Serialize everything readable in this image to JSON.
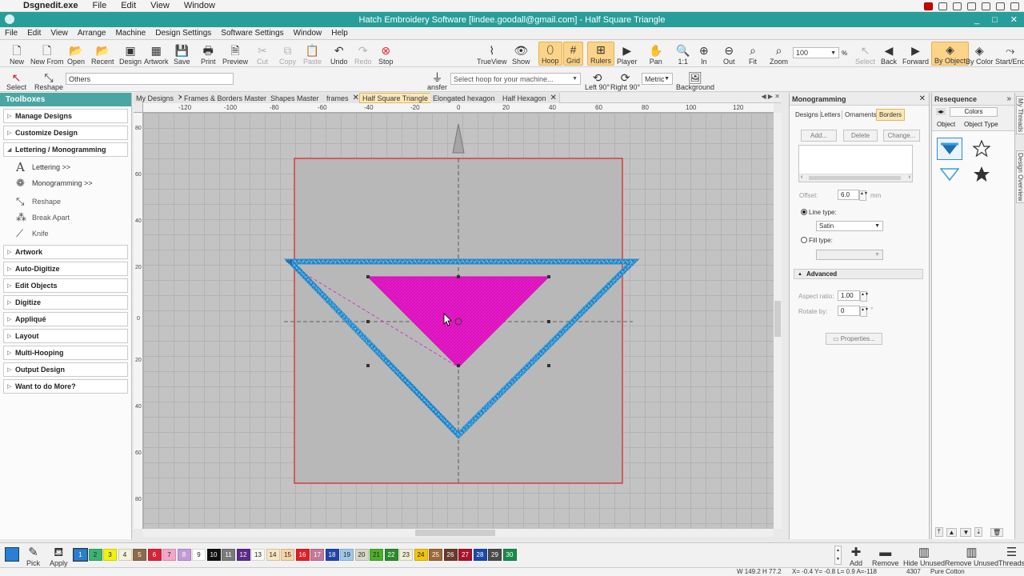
{
  "mac_menu": {
    "app": "Dsgnedit.exe",
    "items": [
      "File",
      "Edit",
      "View",
      "Window"
    ]
  },
  "title": "Hatch Embroidery Software [lindee.goodall@gmail.com] - Half Square Triangle",
  "window_controls": [
    "_",
    "□",
    "✕"
  ],
  "menu": [
    "File",
    "Edit",
    "View",
    "Arrange",
    "Machine",
    "Design Settings",
    "Software Settings",
    "Window",
    "Help"
  ],
  "toolbar": {
    "new": "New",
    "new_from": "New From",
    "open": "Open",
    "recent": "Recent",
    "design": "Design",
    "artwork": "Artwork",
    "save": "Save",
    "print": "Print",
    "preview": "Preview",
    "cut": "Cut",
    "copy": "Copy",
    "paste": "Paste",
    "undo": "Undo",
    "redo": "Redo",
    "stop": "Stop",
    "trueview": "TrueView",
    "show": "Show",
    "hoop": "Hoop",
    "grid": "Grid",
    "rulers": "Rulers",
    "player": "Player",
    "pan": "Pan",
    "one_to_one": "1:1",
    "zoom_in": "In",
    "zoom_out": "Out",
    "fit": "Fit",
    "zoom": "Zoom",
    "zoom_value": "100",
    "zoom_unit": "%",
    "select": "Select",
    "back": "Back",
    "forward": "Forward",
    "by_object": "By Object",
    "by_color": "By Color",
    "start_end": "Start/End"
  },
  "toolbar2": {
    "select": "Select",
    "reshape": "Reshape",
    "others": "Others",
    "transfer": "ansfer",
    "hoop_placeholder": "Select hoop for your machine...",
    "left90": "Left 90°",
    "right90": "Right 90°",
    "metric": "Metric",
    "background": "Background"
  },
  "toolboxes": {
    "header": "Toolboxes",
    "sections_top": [
      "Manage Designs",
      "Customize Design",
      "Lettering / Monogramming"
    ],
    "lettering_items": [
      "Lettering >>",
      "Monogramming >>",
      "Reshape",
      "Break Apart",
      "Knife"
    ],
    "sections_bottom": [
      "Artwork",
      "Auto-Digitize",
      "Edit Objects",
      "Digitize",
      "Appliqué",
      "Layout",
      "Multi-Hooping",
      "Output Design",
      "Want to do More?"
    ]
  },
  "doc_tabs": [
    "My Designs",
    "Frames & Borders Master",
    "Shapes Master",
    "frames",
    "Half Square Triangle",
    "Elongated hexagon",
    "Half Hexagon"
  ],
  "ruler_top": [
    "-120",
    "-100",
    "-80",
    "-60",
    "-40",
    "-20",
    "0",
    "20",
    "40",
    "60",
    "80",
    "100",
    "120"
  ],
  "ruler_left": [
    "80",
    "60",
    "40",
    "20",
    "0",
    "20",
    "40",
    "60",
    "80"
  ],
  "monogramming": {
    "title": "Monogramming",
    "tabs": [
      "Designs",
      "Letters",
      "Ornaments",
      "Borders"
    ],
    "add": "Add...",
    "delete": "Delete",
    "change": "Change...",
    "offset_label": "Offset:",
    "offset_value": "6.0",
    "offset_unit": "mm",
    "line_type": "Line type:",
    "line_value": "Satin",
    "fill_type": "Fill type:",
    "advanced": "Advanced",
    "aspect_label": "Aspect ratio:",
    "aspect_value": "1.00",
    "rotate_label": "Rotate by:",
    "rotate_value": "0",
    "rotate_unit": "°",
    "properties": "Properties..."
  },
  "resequence": {
    "title": "Resequence",
    "colors": "Colors",
    "object": "Object",
    "object_type": "Object Type"
  },
  "side_tabs": [
    "My Threads",
    "Design Overview"
  ],
  "bottom": {
    "pick": "Pick",
    "apply": "Apply",
    "add": "Add",
    "remove": "Remove",
    "hide_unused": "Hide Unused",
    "remove_unused": "Remove Unused",
    "threads": "Threads"
  },
  "swatches": [
    {
      "n": "1",
      "c": "#2a7fd4"
    },
    {
      "n": "2",
      "c": "#3cb371"
    },
    {
      "n": "3",
      "c": "#f2f20c"
    },
    {
      "n": "4",
      "c": "#f5f0dc"
    },
    {
      "n": "5",
      "c": "#8b6b4a"
    },
    {
      "n": "6",
      "c": "#d9223a"
    },
    {
      "n": "7",
      "c": "#f4a6c8"
    },
    {
      "n": "8",
      "c": "#c49ad6"
    },
    {
      "n": "9",
      "c": "#ffffff"
    },
    {
      "n": "10",
      "c": "#111111"
    },
    {
      "n": "11",
      "c": "#7a7a7a"
    },
    {
      "n": "12",
      "c": "#5a2a8a"
    },
    {
      "n": "13",
      "c": "#fbfbf4"
    },
    {
      "n": "14",
      "c": "#f7e6c3"
    },
    {
      "n": "15",
      "c": "#f5d5a8"
    },
    {
      "n": "16",
      "c": "#e11f26"
    },
    {
      "n": "17",
      "c": "#c27a9a"
    },
    {
      "n": "18",
      "c": "#2244a8"
    },
    {
      "n": "19",
      "c": "#9fc8e8"
    },
    {
      "n": "20",
      "c": "#d8d8c8"
    },
    {
      "n": "21",
      "c": "#4caf2a"
    },
    {
      "n": "22",
      "c": "#2c8a2c"
    },
    {
      "n": "23",
      "c": "#f0eed8"
    },
    {
      "n": "24",
      "c": "#f2c40c"
    },
    {
      "n": "25",
      "c": "#9a6a3a"
    },
    {
      "n": "26",
      "c": "#6a3a2a"
    },
    {
      "n": "27",
      "c": "#a8122a"
    },
    {
      "n": "28",
      "c": "#1a4aa8"
    },
    {
      "n": "29",
      "c": "#4a4a4a"
    },
    {
      "n": "30",
      "c": "#1a8a4a"
    }
  ],
  "status": {
    "wh": "W 149.2 H 77.2",
    "coords": "X= -0.4 Y= -0.8 L= 0.9 A=-118",
    "stitches": "4307",
    "thread": "Pure Cotton"
  },
  "colors": {
    "teal": "#289e9a",
    "border_blue": "#3aa0dc",
    "fill_magenta": "#e619c8",
    "hoop_red": "#e01b24"
  }
}
